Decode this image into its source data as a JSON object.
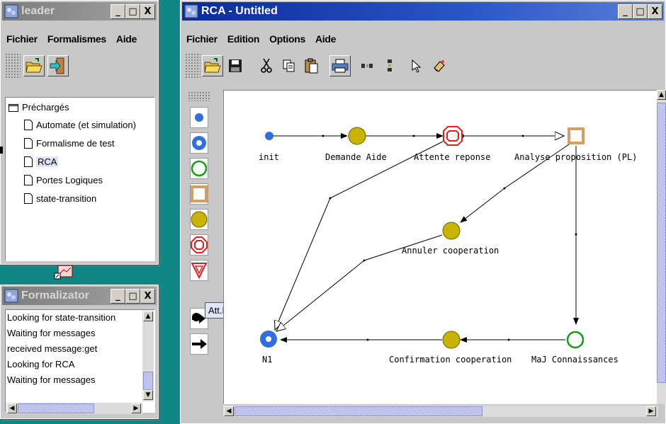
{
  "leader": {
    "title": "leader",
    "menu": [
      "Fichier",
      "Formalismes",
      "Aide"
    ],
    "tree": {
      "root": "Préchargés",
      "items": [
        "Automate (et simulation)",
        "Formalisme de test",
        "RCA",
        "Portes Logiques",
        "state-transition"
      ],
      "selected": "RCA"
    }
  },
  "formalizator": {
    "title": "Formalizator",
    "log": [
      "Looking for state-transition",
      "Waiting for messages",
      "received message:get",
      "Looking for RCA",
      "Waiting for messages"
    ]
  },
  "rca": {
    "title": "RCA - Untitled",
    "menu": [
      "Fichier",
      "Edition",
      "Options",
      "Aide"
    ],
    "tooltip": "Att.Limitee",
    "nodes": {
      "init": "init",
      "demande": "Demande Aide",
      "attente": "Attente reponse",
      "analyse": "Analyse proposition (PL)",
      "annuler": "Annuler cooperation",
      "n1": "N1",
      "confirmation": "Confirmation cooperation",
      "maj": "MaJ Connaissances"
    }
  },
  "window_controls": {
    "minimize": "_",
    "maximize": "□",
    "close": "X"
  },
  "colors": {
    "desktop": "#0f8584",
    "titlebar_active": "#0b2a9c",
    "node_blue": "#2f6fe0",
    "node_olive": "#c8b400",
    "node_red": "#e02020",
    "node_green": "#10a010",
    "node_tan": "#d4a060"
  }
}
